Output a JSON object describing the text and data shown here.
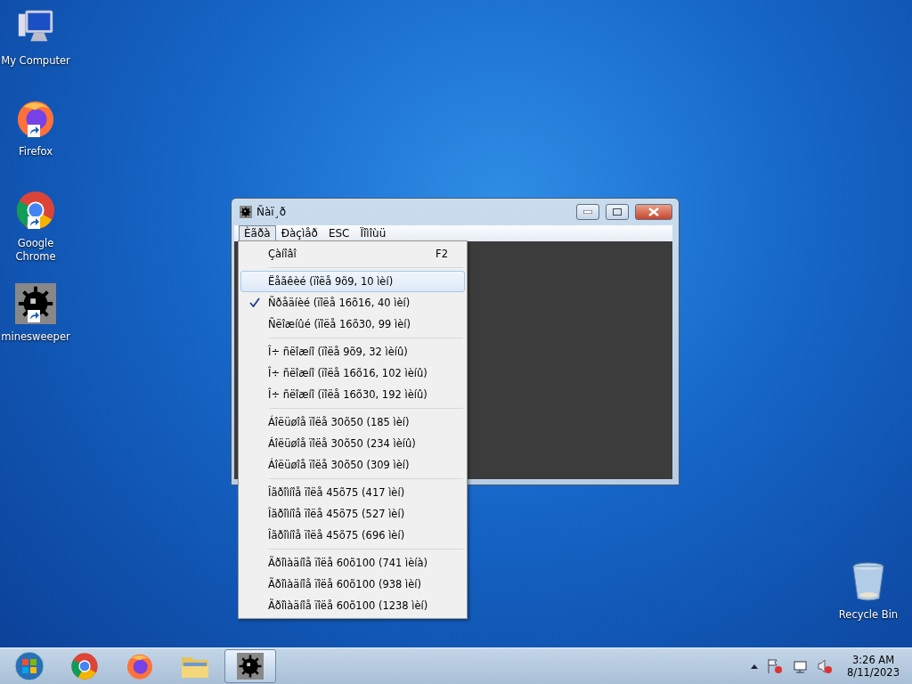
{
  "desktop_icons": [
    {
      "label": "My Computer",
      "kind": "computer"
    },
    {
      "label": "Firefox",
      "kind": "firefox"
    },
    {
      "label": "Google Chrome",
      "kind": "chrome"
    },
    {
      "label": "minesweeper",
      "kind": "mine"
    },
    {
      "label": "Recycle Bin",
      "kind": "bin"
    }
  ],
  "window": {
    "title": "Ñàï¸ð",
    "menubar": [
      {
        "label": "Èãðà",
        "selected": true
      },
      {
        "label": "Ðàçìåð",
        "selected": false
      },
      {
        "label": "ESC",
        "selected": false
      },
      {
        "label": "Ïîìîùü",
        "selected": false
      }
    ],
    "menu": {
      "groups": [
        [
          {
            "label": "Çàíîâî",
            "shortcut": "F2",
            "checked": false,
            "highlighted": false
          }
        ],
        [
          {
            "label": "Ëåãêèé (ïîëå 9õ9, 10 ìèí)",
            "checked": false,
            "highlighted": true
          },
          {
            "label": "Ñðåäíèé (ïîëå 16õ16, 40 ìèí)",
            "checked": true,
            "highlighted": false
          },
          {
            "label": "Ñëîæíûé (ïîëå 16õ30, 99 ìèí)",
            "checked": false,
            "highlighted": false
          }
        ],
        [
          {
            "label": "Î÷ ñëîæíî (ïîëå 9õ9, 32 ìèíû)",
            "checked": false,
            "highlighted": false
          },
          {
            "label": "Î÷ ñëîæíî (ïîëå 16õ16, 102 ìèíû)",
            "checked": false,
            "highlighted": false
          },
          {
            "label": "Î÷ ñëîæíî (ïîëå 16õ30, 192 ìèíû)",
            "checked": false,
            "highlighted": false
          }
        ],
        [
          {
            "label": "Áîëüøîå ïîëå 30õ50 (185 ìèí)",
            "checked": false,
            "highlighted": false
          },
          {
            "label": "Áîëüøîå ïîëå 30õ50 (234 ìèíû)",
            "checked": false,
            "highlighted": false
          },
          {
            "label": "Áîëüøîå ïîëå 30õ50 (309 ìèí)",
            "checked": false,
            "highlighted": false
          }
        ],
        [
          {
            "label": "Îãðîìíîå ïîëå 45õ75 (417 ìèí)",
            "checked": false,
            "highlighted": false
          },
          {
            "label": "Îãðîìíîå ïîëå 45õ75 (527 ìèí)",
            "checked": false,
            "highlighted": false
          },
          {
            "label": "Îãðîìíîå ïîëå 45õ75 (696 ìèí)",
            "checked": false,
            "highlighted": false
          }
        ],
        [
          {
            "label": "Ãðîìàäíîå ïîëå 60õ100 (741 ìèíà)",
            "checked": false,
            "highlighted": false
          },
          {
            "label": "Ãðîìàäíîå ïîëå 60õ100 (938 ìèí)",
            "checked": false,
            "highlighted": false
          },
          {
            "label": "Ãðîìàäíîå ïîëå 60õ100 (1238 ìèí)",
            "checked": false,
            "highlighted": false
          }
        ]
      ]
    }
  },
  "taskbar": {
    "apps": [
      {
        "kind": "chrome",
        "selected": false
      },
      {
        "kind": "firefox",
        "selected": false
      },
      {
        "kind": "folder",
        "selected": false
      },
      {
        "kind": "mine",
        "selected": true
      }
    ],
    "clock": {
      "time": "3:26 AM",
      "date": "8/11/2023"
    }
  }
}
